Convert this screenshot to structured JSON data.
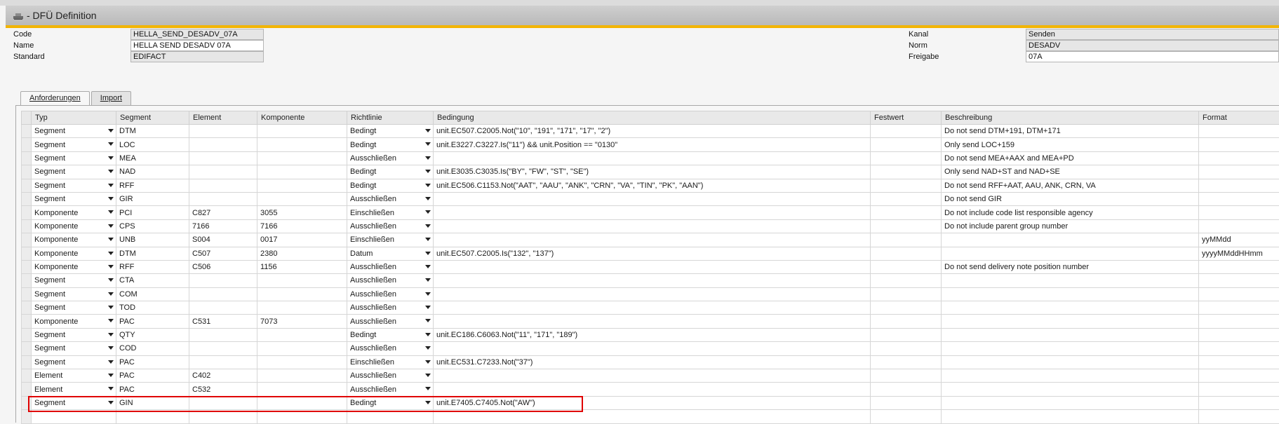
{
  "window": {
    "title": "- DFÜ Definition",
    "icon": "window-icon"
  },
  "form": {
    "code_label": "Code",
    "code_value": "HELLA_SEND_DESADV_07A",
    "name_label": "Name",
    "name_value": "HELLA SEND DESADV 07A",
    "standard_label": "Standard",
    "standard_value": "EDIFACT",
    "kanal_label": "Kanal",
    "kanal_value": "Senden",
    "norm_label": "Norm",
    "norm_value": "DESADV",
    "freigabe_label": "Freigabe",
    "freigabe_value": "07A"
  },
  "tabs": [
    {
      "label": "Anforderungen",
      "active": true
    },
    {
      "label": "Import",
      "active": false
    }
  ],
  "table": {
    "headers": [
      "Typ",
      "Segment",
      "Element",
      "Komponente",
      "Richtlinie",
      "Bedingung",
      "Festwert",
      "Beschreibung",
      "Format"
    ],
    "rows": [
      [
        "Segment",
        "DTM",
        "",
        "",
        "Bedingt",
        "unit.EC507.C2005.Not(\"10\", \"191\", \"171\", \"17\", \"2\")",
        "",
        "Do not send DTM+191, DTM+171",
        ""
      ],
      [
        "Segment",
        "LOC",
        "",
        "",
        "Bedingt",
        "unit.E3227.C3227.Is(\"11\") && unit.Position == \"0130\"",
        "",
        "Only send LOC+159",
        ""
      ],
      [
        "Segment",
        "MEA",
        "",
        "",
        "Ausschließen",
        "",
        "",
        "Do not send MEA+AAX and MEA+PD",
        ""
      ],
      [
        "Segment",
        "NAD",
        "",
        "",
        "Bedingt",
        "unit.E3035.C3035.Is(\"BY\", \"FW\", \"ST\", \"SE\")",
        "",
        "Only send NAD+ST and NAD+SE",
        ""
      ],
      [
        "Segment",
        "RFF",
        "",
        "",
        "Bedingt",
        "unit.EC506.C1153.Not(\"AAT\", \"AAU\", \"ANK\", \"CRN\", \"VA\", \"TIN\", \"PK\", \"AAN\")",
        "",
        "Do not send RFF+AAT, AAU, ANK, CRN, VA",
        ""
      ],
      [
        "Segment",
        "GIR",
        "",
        "",
        "Ausschließen",
        "",
        "",
        "Do not send GIR",
        ""
      ],
      [
        "Komponente",
        "PCI",
        "C827",
        "3055",
        "Einschließen",
        "",
        "",
        "Do not include code list responsible agency",
        ""
      ],
      [
        "Komponente",
        "CPS",
        "7166",
        "7166",
        "Ausschließen",
        "",
        "",
        "Do not include parent group number",
        ""
      ],
      [
        "Komponente",
        "UNB",
        "S004",
        "0017",
        "Einschließen",
        "",
        "",
        "",
        "yyMMdd"
      ],
      [
        "Komponente",
        "DTM",
        "C507",
        "2380",
        "Datum",
        "unit.EC507.C2005.Is(\"132\", \"137\")",
        "",
        "",
        "yyyyMMddHHmm"
      ],
      [
        "Komponente",
        "RFF",
        "C506",
        "1156",
        "Ausschließen",
        "",
        "",
        "Do not send delivery note position number",
        ""
      ],
      [
        "Segment",
        "CTA",
        "",
        "",
        "Ausschließen",
        "",
        "",
        "",
        ""
      ],
      [
        "Segment",
        "COM",
        "",
        "",
        "Ausschließen",
        "",
        "",
        "",
        ""
      ],
      [
        "Segment",
        "TOD",
        "",
        "",
        "Ausschließen",
        "",
        "",
        "",
        ""
      ],
      [
        "Komponente",
        "PAC",
        "C531",
        "7073",
        "Ausschließen",
        "",
        "",
        "",
        ""
      ],
      [
        "Segment",
        "QTY",
        "",
        "",
        "Bedingt",
        "unit.EC186.C6063.Not(\"11\", \"171\", \"189\")",
        "",
        "",
        ""
      ],
      [
        "Segment",
        "COD",
        "",
        "",
        "Ausschließen",
        "",
        "",
        "",
        ""
      ],
      [
        "Segment",
        "PAC",
        "",
        "",
        "Einschließen",
        "unit.EC531.C7233.Not(\"37\")",
        "",
        "",
        ""
      ],
      [
        "Element",
        "PAC",
        "C402",
        "",
        "Ausschließen",
        "",
        "",
        "",
        ""
      ],
      [
        "Element",
        "PAC",
        "C532",
        "",
        "Ausschließen",
        "",
        "",
        "",
        ""
      ],
      [
        "Segment",
        "GIN",
        "",
        "",
        "Bedingt",
        "unit.E7405.C7405.Not(\"AW\")",
        "",
        "",
        ""
      ],
      [
        "",
        "",
        "",
        "",
        "",
        "",
        "",
        "",
        ""
      ]
    ]
  },
  "colors": {
    "accent": "#f2b400",
    "highlight": "#e00000"
  }
}
